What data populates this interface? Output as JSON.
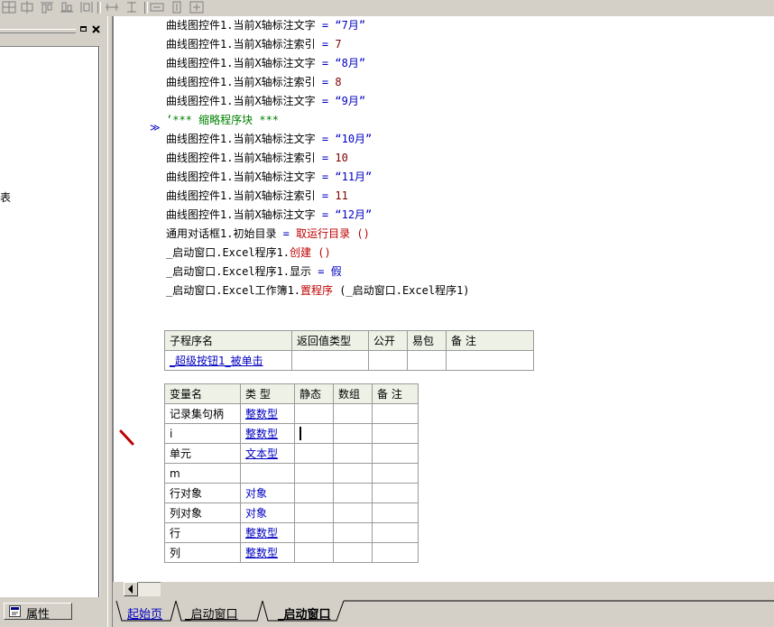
{
  "left_panel": {
    "partial_text": "表",
    "properties_tab": "属性",
    "icons": [
      "restore-icon",
      "close-icon"
    ]
  },
  "code_lines": [
    {
      "obj": "曲线图控件1.当前X轴标注文字",
      "op": " = ",
      "val": "“7月”",
      "kind": "str"
    },
    {
      "obj": "曲线图控件1.当前X轴标注索引",
      "op": " = ",
      "val": "7",
      "kind": "num"
    },
    {
      "obj": "曲线图控件1.当前X轴标注文字",
      "op": " = ",
      "val": "“8月”",
      "kind": "str"
    },
    {
      "obj": "曲线图控件1.当前X轴标注索引",
      "op": " = ",
      "val": "8",
      "kind": "num"
    },
    {
      "obj": "曲线图控件1.当前X轴标注文字",
      "op": " = ",
      "val": "“9月”",
      "kind": "str"
    },
    {
      "obj": "",
      "op": "",
      "val": "’*** 缩略程序块 ***",
      "kind": "cmt"
    },
    {
      "obj": "曲线图控件1.当前X轴标注文字",
      "op": " = ",
      "val": "“10月”",
      "kind": "str"
    },
    {
      "obj": "曲线图控件1.当前X轴标注索引",
      "op": " = ",
      "val": "10",
      "kind": "num"
    },
    {
      "obj": "曲线图控件1.当前X轴标注文字",
      "op": " = ",
      "val": "“11月”",
      "kind": "str"
    },
    {
      "obj": "曲线图控件1.当前X轴标注索引",
      "op": " = ",
      "val": "11",
      "kind": "num"
    },
    {
      "obj": "曲线图控件1.当前X轴标注文字",
      "op": " = ",
      "val": "“12月”",
      "kind": "str"
    },
    {
      "obj": "通用对话框1.初始目录",
      "op": " = ",
      "val": "取运行目录 ()",
      "kind": "fn"
    },
    {
      "obj": "_启动窗口.Excel程序1.",
      "op": "",
      "val": "创建 ()",
      "kind": "fn"
    },
    {
      "obj": "_启动窗口.Excel程序1.显示",
      "op": " = ",
      "val": "假",
      "kind": "op"
    },
    {
      "obj": "_启动窗口.Excel工作簿1.",
      "op": "",
      "val": "置程序 (_启动窗口.Excel程序1)",
      "kind": "fnmix",
      "fn_part": "置程序",
      "rest_part": " (_启动窗口.Excel程序1)"
    }
  ],
  "collapse_marker": "≫",
  "proc_table": {
    "headers": [
      "子程序名",
      "返回值类型",
      "公开",
      "易包",
      "备 注"
    ],
    "row": [
      "_超级按钮1_被单击",
      "",
      "",
      "",
      ""
    ]
  },
  "var_table": {
    "headers": [
      "变量名",
      "类 型",
      "静态",
      "数组",
      "备 注"
    ],
    "rows": [
      [
        "记录集句柄",
        "整数型",
        "",
        "",
        ""
      ],
      [
        "i",
        "整数型",
        "",
        "",
        ""
      ],
      [
        "单元",
        "文本型",
        "",
        "",
        ""
      ],
      [
        "m",
        "",
        "",
        "",
        ""
      ],
      [
        "行对象",
        "对象",
        "",
        "",
        ""
      ],
      [
        "列对象",
        "对象",
        "",
        "",
        ""
      ],
      [
        "行",
        "整数型",
        "",
        "",
        ""
      ],
      [
        "列",
        "整数型",
        "",
        "",
        ""
      ]
    ]
  },
  "tabs": {
    "home": "起始页",
    "window1": "_启动窗口",
    "window2": "_启动窗口"
  }
}
